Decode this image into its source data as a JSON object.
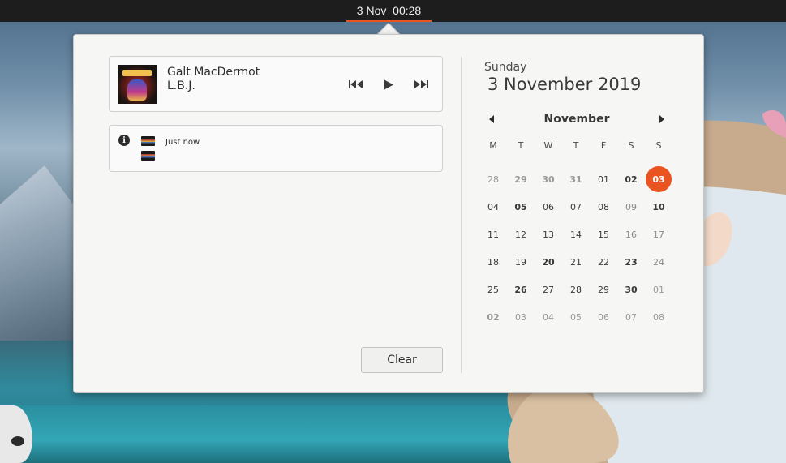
{
  "topbar": {
    "date": "3 Nov",
    "time": "00:28"
  },
  "media": {
    "artist": "Galt MacDermot",
    "track": "L.B.J.",
    "icons": {
      "art": "album-art",
      "prev": "skip-previous-icon",
      "play": "play-icon",
      "next": "skip-next-icon"
    }
  },
  "notification": {
    "time": "Just now",
    "icon": "info-icon"
  },
  "clear_label": "Clear",
  "calendar": {
    "weekday": "Sunday",
    "date_full": "3 November 2019",
    "month": "November",
    "accent": "#e95420",
    "weekdays": [
      "M",
      "T",
      "W",
      "T",
      "F",
      "S",
      "S"
    ],
    "weeks": [
      [
        {
          "d": "28",
          "other": true
        },
        {
          "d": "29",
          "other": true,
          "bold": true
        },
        {
          "d": "30",
          "other": true,
          "bold": true
        },
        {
          "d": "31",
          "other": true,
          "bold": true
        },
        {
          "d": "01"
        },
        {
          "d": "02",
          "bold": true
        },
        {
          "d": "03",
          "today": true
        }
      ],
      [
        {
          "d": "04"
        },
        {
          "d": "05",
          "bold": true
        },
        {
          "d": "06"
        },
        {
          "d": "07"
        },
        {
          "d": "08"
        },
        {
          "d": "09",
          "weekend": true
        },
        {
          "d": "10",
          "bold": true
        }
      ],
      [
        {
          "d": "11"
        },
        {
          "d": "12"
        },
        {
          "d": "13"
        },
        {
          "d": "14"
        },
        {
          "d": "15"
        },
        {
          "d": "16",
          "weekend": true
        },
        {
          "d": "17",
          "weekend": true
        }
      ],
      [
        {
          "d": "18"
        },
        {
          "d": "19"
        },
        {
          "d": "20",
          "bold": true
        },
        {
          "d": "21"
        },
        {
          "d": "22"
        },
        {
          "d": "23",
          "bold": true
        },
        {
          "d": "24",
          "weekend": true
        }
      ],
      [
        {
          "d": "25"
        },
        {
          "d": "26",
          "bold": true
        },
        {
          "d": "27"
        },
        {
          "d": "28"
        },
        {
          "d": "29"
        },
        {
          "d": "30",
          "bold": true
        },
        {
          "d": "01",
          "other": true
        }
      ],
      [
        {
          "d": "02",
          "other": true,
          "bold": true
        },
        {
          "d": "03",
          "other": true
        },
        {
          "d": "04",
          "other": true
        },
        {
          "d": "05",
          "other": true
        },
        {
          "d": "06",
          "other": true
        },
        {
          "d": "07",
          "other": true
        },
        {
          "d": "08",
          "other": true
        }
      ]
    ]
  }
}
